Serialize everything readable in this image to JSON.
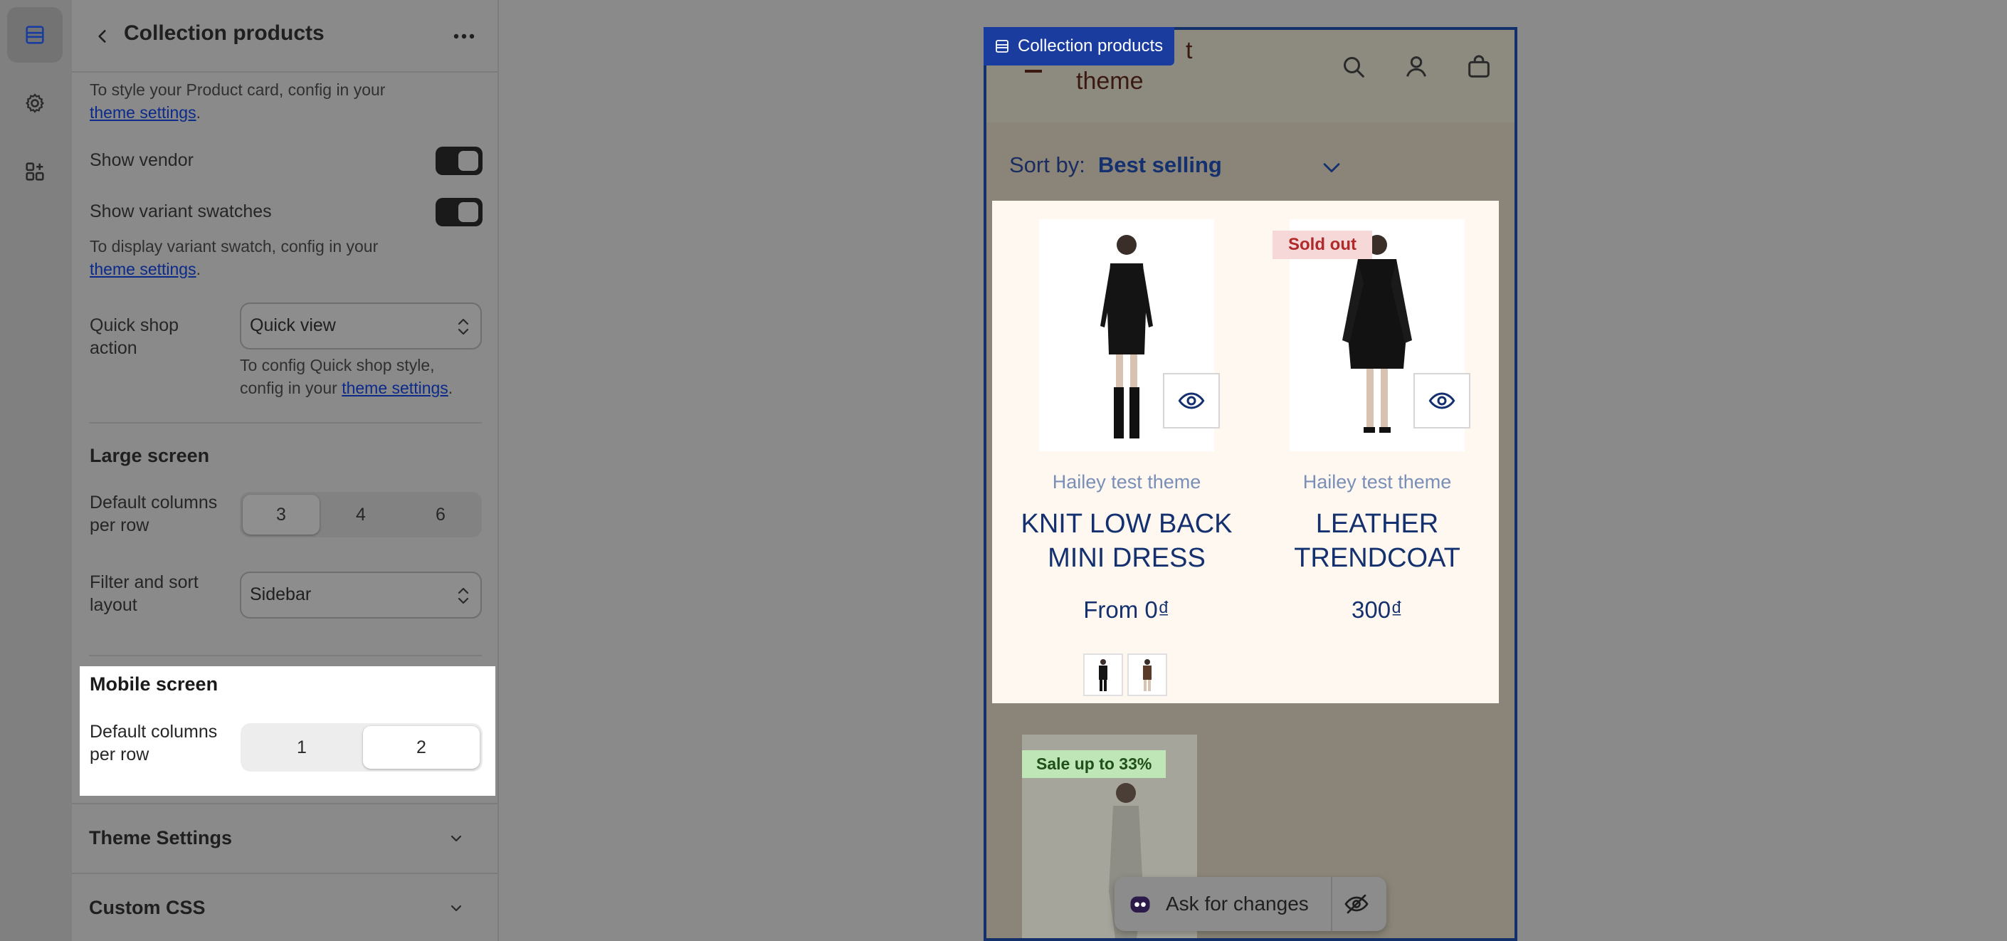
{
  "sidebar_rail": {
    "items": [
      {
        "name": "sections",
        "icon": "sections-icon"
      },
      {
        "name": "settings",
        "icon": "gear-icon"
      },
      {
        "name": "apps",
        "icon": "apps-icon"
      }
    ]
  },
  "panel": {
    "title": "Collection products",
    "product_card_hint_prefix": "To style your Product card, config in your",
    "product_card_hint_link": "theme settings",
    "show_vendor_label": "Show vendor",
    "show_vendor_on": true,
    "show_swatches_label": "Show variant swatches",
    "show_swatches_on": true,
    "swatch_hint_prefix": "To display variant swatch, config in your",
    "swatch_hint_link": "theme settings",
    "quick_shop_label_1": "Quick shop",
    "quick_shop_label_2": "action",
    "quick_shop_value": "Quick view",
    "quick_shop_hint_1": "To config Quick shop style,",
    "quick_shop_hint_2": "config in your",
    "quick_shop_hint_link": "theme settings",
    "large_screen": {
      "title": "Large screen",
      "columns_label_1": "Default columns",
      "columns_label_2": "per row",
      "column_options": [
        "3",
        "4",
        "6"
      ],
      "selected": "3",
      "filter_label_1": "Filter and sort",
      "filter_label_2": "layout",
      "filter_value": "Sidebar"
    },
    "mobile_screen": {
      "title": "Mobile screen",
      "columns_label_1": "Default columns",
      "columns_label_2": "per row",
      "column_options": [
        "1",
        "2"
      ],
      "selected": "2"
    },
    "theme_settings_label": "Theme Settings",
    "custom_css_label": "Custom CSS"
  },
  "preview": {
    "section_badge": "Collection products",
    "brand_top": "t",
    "brand_bottom": "theme",
    "sort_label": "Sort by:",
    "sort_value": "Best selling",
    "products": [
      {
        "vendor": "Hailey test theme",
        "title_1": "KNIT LOW BACK",
        "title_2": "MINI DRESS",
        "price": "From 0₫",
        "badge": ""
      },
      {
        "vendor": "Hailey test theme",
        "title_1": "LEATHER",
        "title_2": "TRENDCOAT",
        "price": "300₫",
        "badge": "Sold out"
      }
    ],
    "third_badge": "Sale up to 33%"
  },
  "ask_bar": {
    "label": "Ask for changes"
  },
  "colors": {
    "accent_blue": "#13306b",
    "badge_blue": "#1a3c9e",
    "product_text": "#14306e",
    "sold_out": "#b02a2a",
    "sale": "#1f4f1a"
  }
}
